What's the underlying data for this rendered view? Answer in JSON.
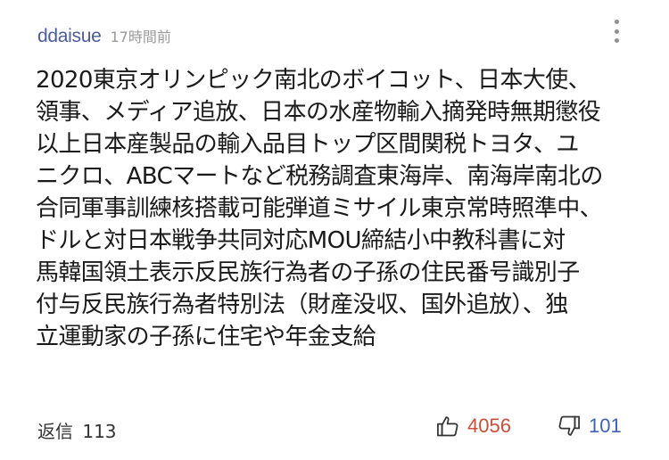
{
  "comment": {
    "username": "ddaisue",
    "timestamp": "17時間前",
    "body": "2020東京オリンピック南北のボイコット、日本大使、\n領事、メディア追放、日本の水産物輸入摘発時無期懲役\n以上日本産製品の輸入品目トップ区間関税トヨタ、ユ\nニクロ、ABCマートなど税務調査東海岸、南海岸南北の\n合同軍事訓練核搭載可能弾道ミサイル東京常時照準中、\nドルと対日本戦争共同対応MOU締結小中教科書に対\n馬韓国領土表示反民族行為者の子孫の住民番号識別子\n付与反民族行為者特別法（財産没収、国外追放）、独\n立運動家の子孫に住宅や年金支給"
  },
  "footer": {
    "reply_label": "返信",
    "reply_count": "113",
    "likes": "4056",
    "dislikes": "101"
  },
  "icons": {
    "menu": "more-vertical-icon",
    "like": "thumbs-up-icon",
    "dislike": "thumbs-down-icon"
  },
  "colors": {
    "username": "#4b5c9a",
    "likes": "#c8503b",
    "dislikes": "#3e63b6",
    "timestamp": "#9a9a9a"
  }
}
